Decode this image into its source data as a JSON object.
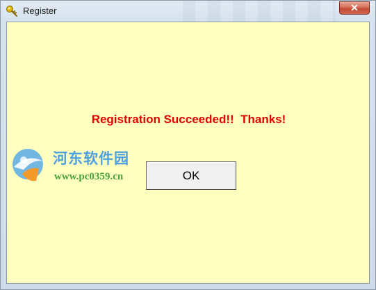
{
  "window": {
    "title": "Register",
    "close_symbol": "✕",
    "icons": {
      "app": "key-icon",
      "close": "close-icon"
    }
  },
  "dialog": {
    "message": "Registration Succeeded!!  Thanks!",
    "ok_label": "OK"
  },
  "watermark": {
    "site_name": "河东软件园",
    "url": "www.pc0359.cn"
  },
  "colors": {
    "client_background": "#ffffc0",
    "message_text": "#e00000",
    "button_face": "#f0f0f0"
  }
}
